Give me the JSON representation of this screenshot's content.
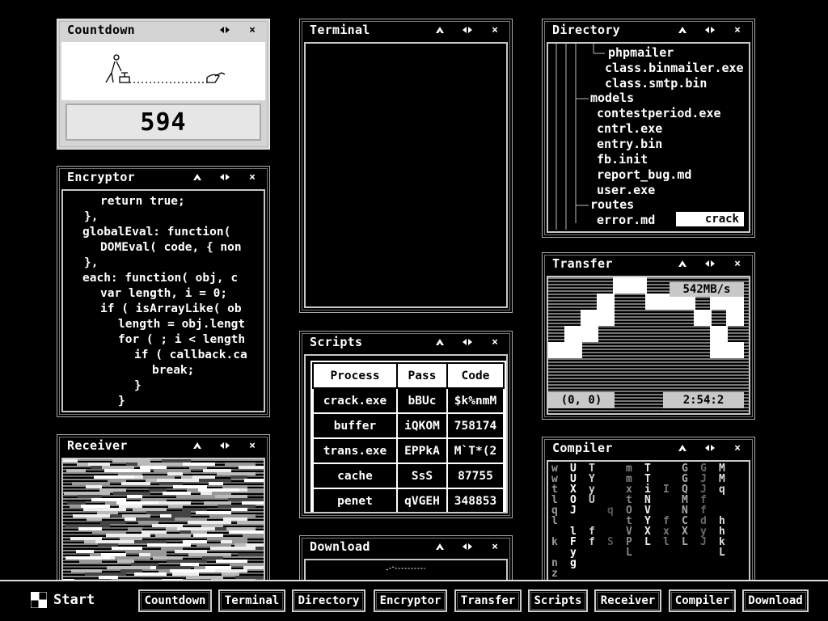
{
  "windows": {
    "countdown": {
      "title": "Countdown",
      "value": "594"
    },
    "terminal": {
      "title": "Terminal"
    },
    "directory": {
      "title": "Directory",
      "items": [
        "phpmailer",
        "class.binmailer.exe",
        "class.smtp.bin",
        "models",
        "contestperiod.exe",
        "cntrl.exe",
        "entry.bin",
        "fb.init",
        "report_bug.md",
        "user.exe",
        "routes",
        "error.md"
      ],
      "badge": "crack"
    },
    "encryptor": {
      "title": "Encryptor",
      "lines": [
        "return true;",
        "},",
        "globalEval: function(",
        "DOMEval( code, { non",
        "},",
        "each: function( obj, c",
        "var length, i = 0;",
        "if ( isArrayLike( ob",
        "length = obj.lengt",
        "for ( ; i < length",
        "if ( callback.ca",
        "break;",
        "}",
        "}"
      ]
    },
    "transfer": {
      "title": "Transfer",
      "rate": "542MB/s",
      "coords": "(0, 0)",
      "time": "2:54:2"
    },
    "scripts": {
      "title": "Scripts",
      "headers": [
        "Process",
        "Pass",
        "Code"
      ],
      "rows": [
        [
          "crack.exe",
          "bBUc",
          "$k%nmM"
        ],
        [
          "buffer",
          "iQKOM",
          "758174"
        ],
        [
          "trans.exe",
          "EPPkA",
          "M`T*(2"
        ],
        [
          "cache",
          "SsS",
          "87755"
        ],
        [
          "penet",
          "qVGEH",
          "348853"
        ]
      ]
    },
    "receiver": {
      "title": "Receiver"
    },
    "compiler": {
      "title": "Compiler",
      "columns": [
        "wwtlql k nz",
        "UUXOJ lFyg",
        "TYyU  ff",
        "    q  S",
        "mmxtOtVPL",
        "TTiNVYXL",
        "  I  fxl",
        "GGQMNCXL",
        "GJJffdyJ",
        "MMq  hhkL"
      ]
    },
    "download": {
      "title": "Download"
    }
  },
  "controls": {
    "move": "move-arrows",
    "minimize": "up-arrow",
    "close": "×"
  },
  "taskbar": {
    "start_label": "Start",
    "buttons": [
      "Countdown",
      "Terminal",
      "Directory",
      "Encryptor",
      "Transfer",
      "Scripts",
      "Receiver",
      "Compiler",
      "Download"
    ]
  }
}
